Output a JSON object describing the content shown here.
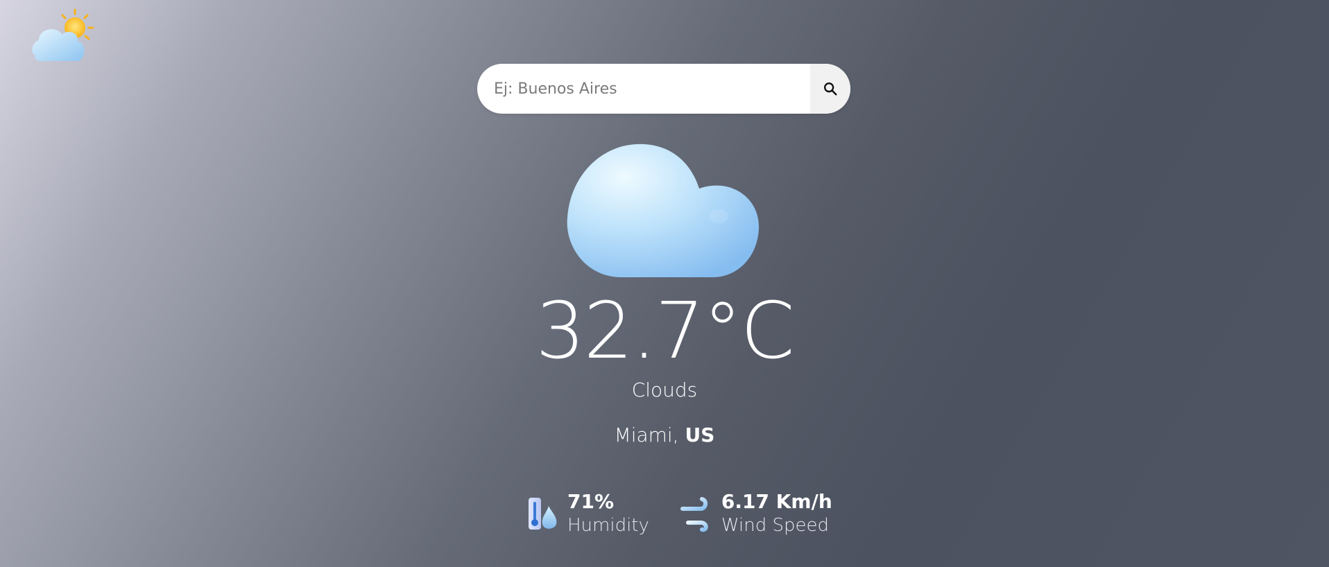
{
  "logo": {
    "icon": "partly-cloudy-icon"
  },
  "search": {
    "placeholder": "Ej: Buenos Aires",
    "value": "",
    "button_icon": "search-icon"
  },
  "weather": {
    "icon": "cloud-icon",
    "temperature": "32.7°C",
    "condition": "Clouds",
    "city": "Miami,",
    "country": "US"
  },
  "stats": {
    "humidity": {
      "icon": "humidity-icon",
      "value": "71%",
      "label": "Humidity"
    },
    "wind": {
      "icon": "wind-icon",
      "value": "6.17 Km/h",
      "label": "Wind Speed"
    }
  },
  "colors": {
    "accent_white": "#ffffff",
    "cloud_light": "#d9f1ff",
    "cloud_dark": "#8fc3f2",
    "sun": "#ffc93c"
  }
}
